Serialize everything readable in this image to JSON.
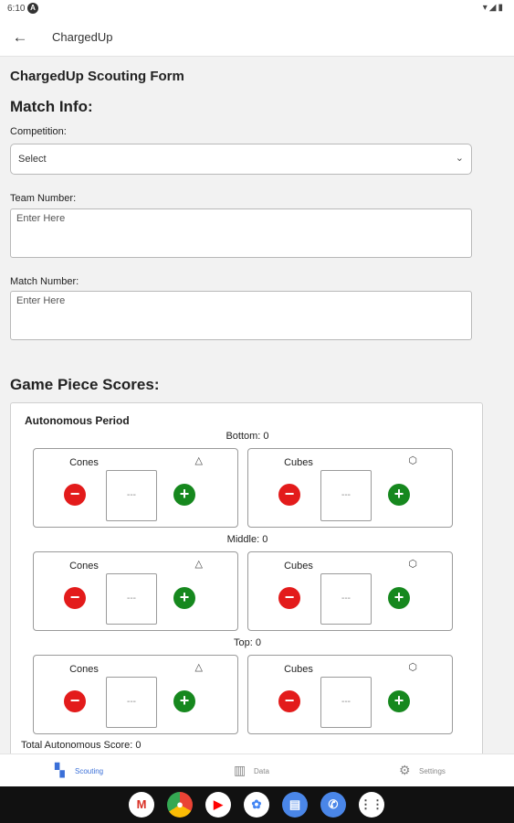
{
  "status_bar": {
    "time": "6:10"
  },
  "app_bar": {
    "title": "ChargedUp"
  },
  "form": {
    "title": "ChargedUp Scouting Form",
    "match_info_heading": "Match Info:",
    "competition": {
      "label": "Competition:",
      "value": "Select"
    },
    "team_number": {
      "label": "Team Number:",
      "placeholder": "Enter Here"
    },
    "match_number": {
      "label": "Match Number:",
      "placeholder": "Enter Here"
    },
    "game_piece_heading": "Game Piece Scores:"
  },
  "autonomous": {
    "title": "Autonomous Period",
    "levels": [
      {
        "label": "Bottom: 0",
        "cones_label": "Cones",
        "cones_value": "---",
        "cubes_label": "Cubes",
        "cubes_value": "---"
      },
      {
        "label": "Middle: 0",
        "cones_label": "Cones",
        "cones_value": "---",
        "cubes_label": "Cubes",
        "cubes_value": "---"
      },
      {
        "label": "Top: 0",
        "cones_label": "Cones",
        "cones_value": "---",
        "cubes_label": "Cubes",
        "cubes_value": "---"
      }
    ],
    "total": "Total Autonomous Score: 0"
  },
  "bottom_nav": {
    "scouting": "Scouting",
    "data": "Data",
    "settings": "Settings"
  },
  "colors": {
    "minus": "#e31b1b",
    "plus": "#16881e",
    "accent": "#3a6fd8"
  }
}
